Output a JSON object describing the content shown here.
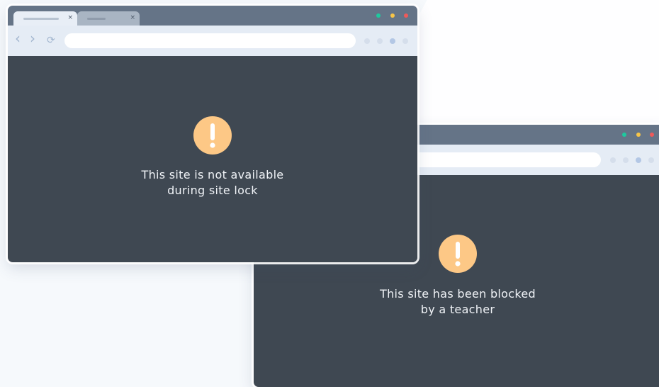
{
  "colors": {
    "page_bg": "#f6f9fc",
    "titlebar": "#657487",
    "toolbar": "#e5ecf5",
    "content_bg": "#3f4852",
    "alert_fill": "#fdc886",
    "dot_green": "#1ec99e",
    "dot_yellow": "#f7c548",
    "dot_red": "#ef5a5a"
  },
  "front_browser": {
    "tabs": [
      {
        "close": "×",
        "state": "active"
      },
      {
        "close": "×",
        "state": "inactive"
      }
    ],
    "nav": {
      "back": "‹",
      "forward": "›",
      "reload": "⟳"
    },
    "address_value": "",
    "alert_icon": "exclamation-icon",
    "message_line1": "This site is not available",
    "message_line2": "during site lock"
  },
  "back_browser": {
    "address_value": "",
    "alert_icon": "exclamation-icon",
    "message_line1": "This site has been blocked",
    "message_line2": "by a teacher"
  }
}
